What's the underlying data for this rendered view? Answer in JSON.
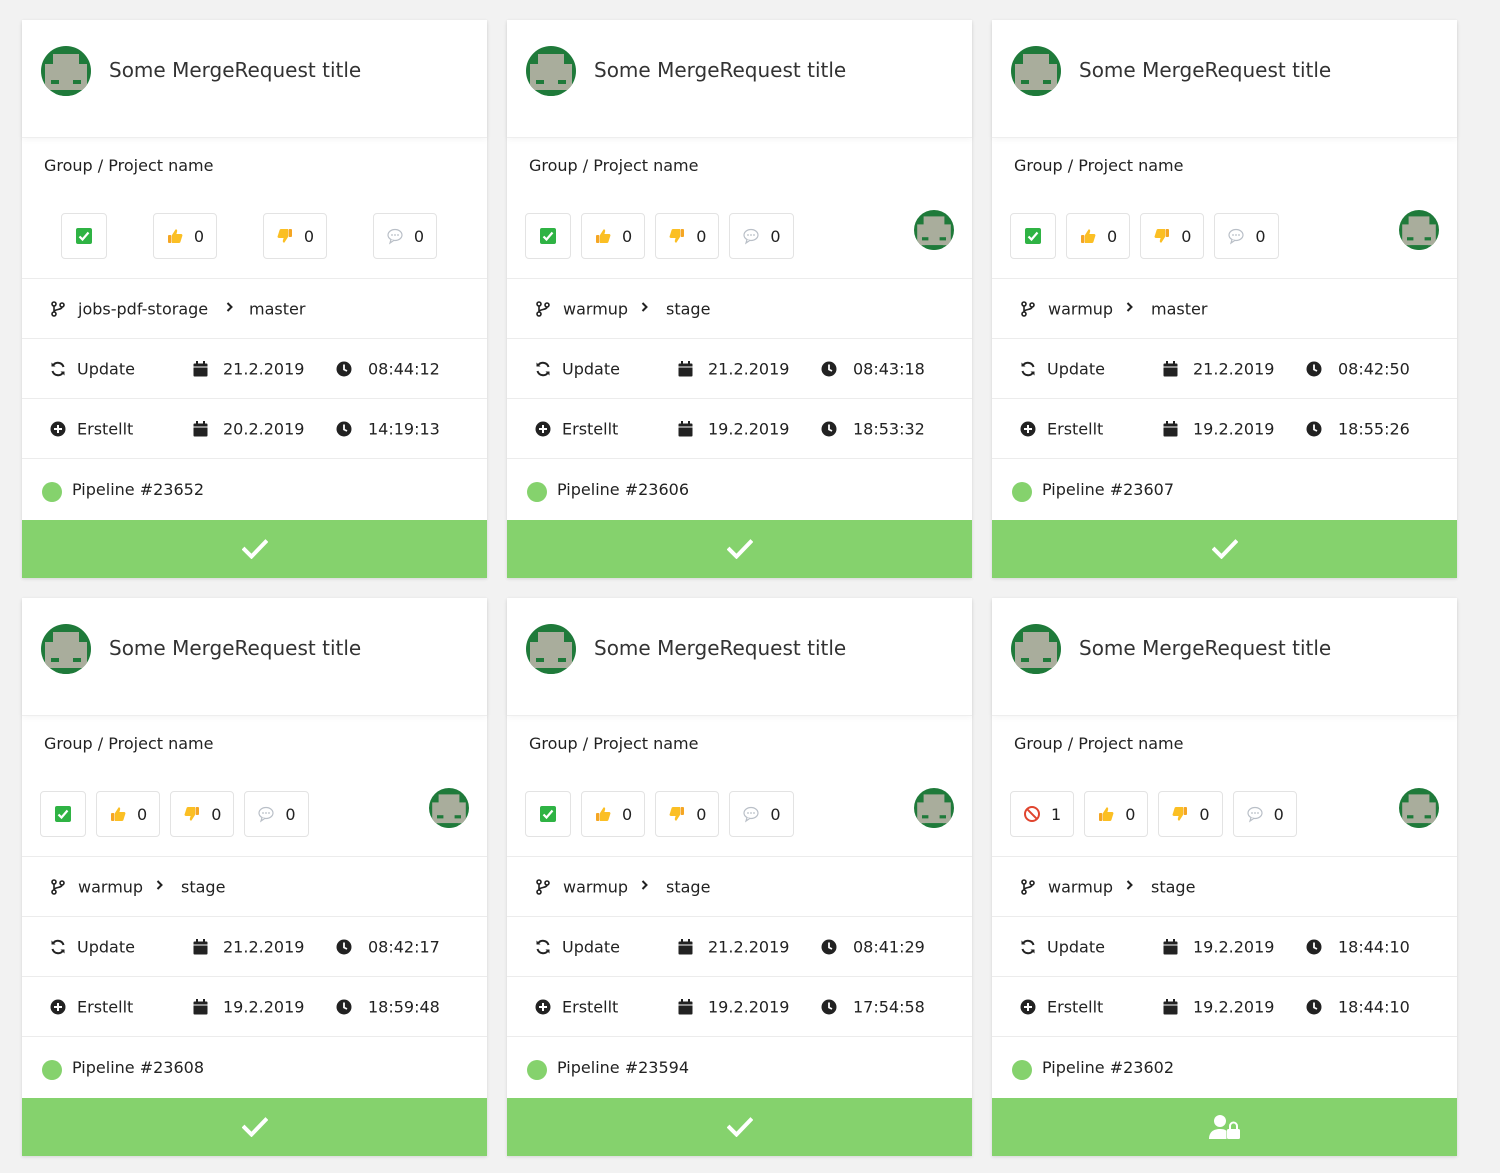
{
  "cards": [
    {
      "title": "Some MergeRequest title",
      "project": "Group / Project name",
      "approval": "check",
      "approval_count": "",
      "thumbs_up": "0",
      "thumbs_down": "0",
      "comments": "0",
      "show_assignee": false,
      "source_branch": "jobs-pdf-storage",
      "target_branch": "master",
      "updated_label": "Update",
      "updated_date": "21.2.2019",
      "updated_time": "08:44:12",
      "created_label": "Erstellt",
      "created_date": "20.2.2019",
      "created_time": "14:19:13",
      "pipeline": "Pipeline #23652",
      "status_icon": "check-icon"
    },
    {
      "title": "Some MergeRequest title",
      "project": "Group / Project name",
      "approval": "check",
      "approval_count": "",
      "thumbs_up": "0",
      "thumbs_down": "0",
      "comments": "0",
      "show_assignee": true,
      "source_branch": "warmup",
      "target_branch": "stage",
      "updated_label": "Update",
      "updated_date": "21.2.2019",
      "updated_time": "08:43:18",
      "created_label": "Erstellt",
      "created_date": "19.2.2019",
      "created_time": "18:53:32",
      "pipeline": "Pipeline #23606",
      "status_icon": "check-icon"
    },
    {
      "title": "Some MergeRequest title",
      "project": "Group / Project name",
      "approval": "check",
      "approval_count": "",
      "thumbs_up": "0",
      "thumbs_down": "0",
      "comments": "0",
      "show_assignee": true,
      "source_branch": "warmup",
      "target_branch": "master",
      "updated_label": "Update",
      "updated_date": "21.2.2019",
      "updated_time": "08:42:50",
      "created_label": "Erstellt",
      "created_date": "19.2.2019",
      "created_time": "18:55:26",
      "pipeline": "Pipeline #23607",
      "status_icon": "check-icon"
    },
    {
      "title": "Some MergeRequest title",
      "project": "Group / Project name",
      "approval": "check",
      "approval_count": "",
      "thumbs_up": "0",
      "thumbs_down": "0",
      "comments": "0",
      "show_assignee": true,
      "source_branch": "warmup",
      "target_branch": "stage",
      "updated_label": "Update",
      "updated_date": "21.2.2019",
      "updated_time": "08:42:17",
      "created_label": "Erstellt",
      "created_date": "19.2.2019",
      "created_time": "18:59:48",
      "pipeline": "Pipeline #23608",
      "status_icon": "check-icon"
    },
    {
      "title": "Some MergeRequest title",
      "project": "Group / Project name",
      "approval": "check",
      "approval_count": "",
      "thumbs_up": "0",
      "thumbs_down": "0",
      "comments": "0",
      "show_assignee": true,
      "source_branch": "warmup",
      "target_branch": "stage",
      "updated_label": "Update",
      "updated_date": "21.2.2019",
      "updated_time": "08:41:29",
      "created_label": "Erstellt",
      "created_date": "19.2.2019",
      "created_time": "17:54:58",
      "pipeline": "Pipeline #23594",
      "status_icon": "check-icon"
    },
    {
      "title": "Some MergeRequest title",
      "project": "Group / Project name",
      "approval": "blocked",
      "approval_count": "1",
      "thumbs_up": "0",
      "thumbs_down": "0",
      "comments": "0",
      "show_assignee": true,
      "source_branch": "warmup",
      "target_branch": "stage",
      "updated_label": "Update",
      "updated_date": "19.2.2019",
      "updated_time": "18:44:10",
      "created_label": "Erstellt",
      "created_date": "19.2.2019",
      "created_time": "18:44:10",
      "pipeline": "Pipeline #23602",
      "status_icon": "user-lock-icon"
    }
  ],
  "colors": {
    "pipeline_success": "#85d26d",
    "avatar_green": "#1f7a3a",
    "avatar_gray": "#a9ad9c"
  }
}
